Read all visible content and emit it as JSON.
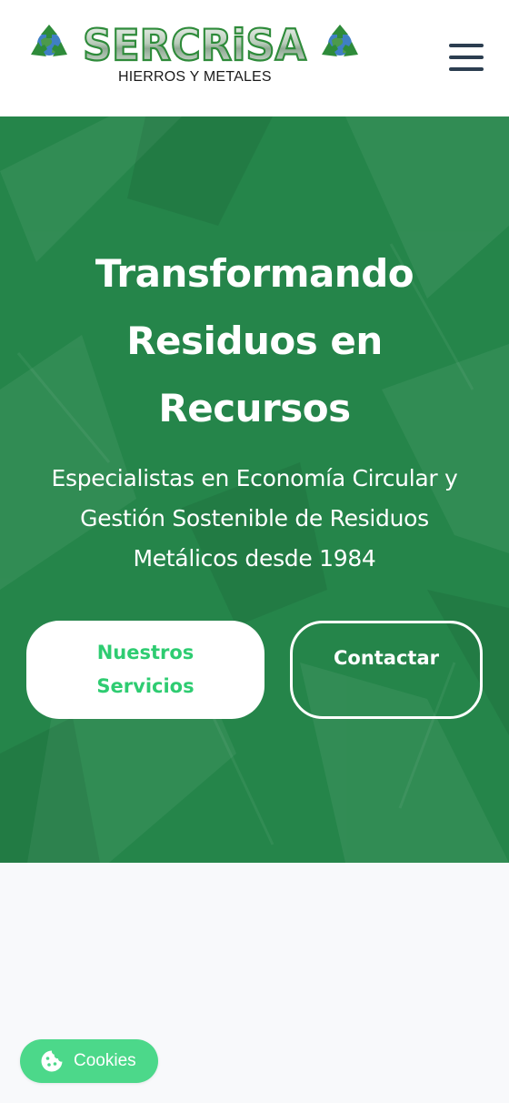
{
  "header": {
    "logo": {
      "wordmark": "SERCRiSA",
      "tagline": "HIERROS Y METALES"
    },
    "menu_icon": "hamburger-menu-icon"
  },
  "hero": {
    "title": "Transformando Residuos en Recursos",
    "subtitle": "Especialistas en Economía Circular y Gestión Sostenible de Residuos Metálicos desde 1984",
    "primary_button": "Nuestros Servicios",
    "secondary_button": "Contactar"
  },
  "cookies": {
    "label": "Cookies",
    "icon": "cookie-icon"
  },
  "colors": {
    "hero_green": "#25854a",
    "accent_green": "#2ecc71",
    "cookie_green": "#4cd88a",
    "menu_icon": "#2c3e50",
    "page_background": "#f8f9fb"
  }
}
